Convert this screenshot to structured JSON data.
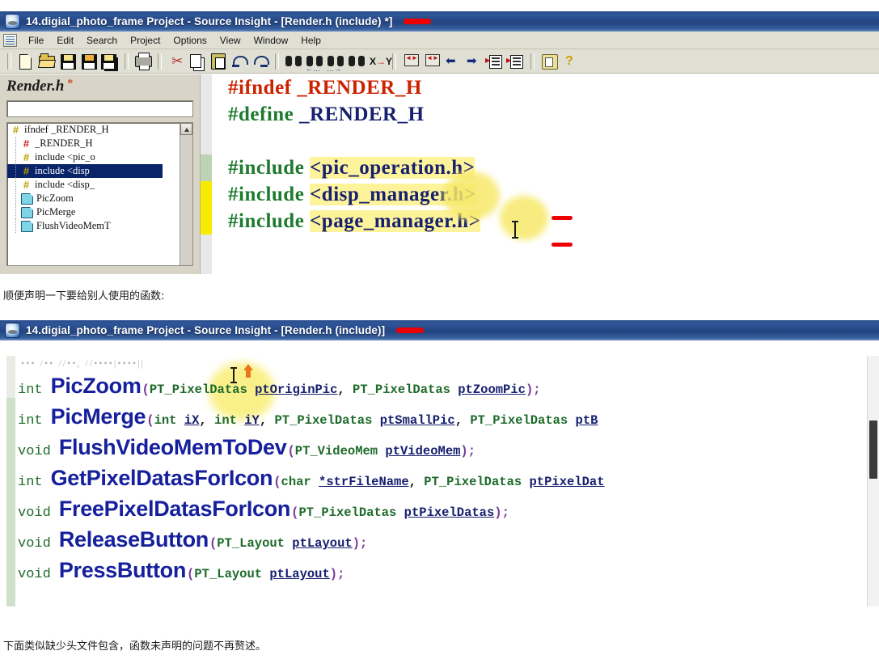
{
  "window1": {
    "title": "14.digial_photo_frame Project - Source Insight - [Render.h (include) *]",
    "title_annotation": "red-dash",
    "menu": [
      "File",
      "Edit",
      "Search",
      "Project",
      "Options",
      "View",
      "Window",
      "Help"
    ],
    "toolbar_icons": [
      "new-file-icon",
      "open-folder-icon",
      "save-icon",
      "save-as-icon",
      "save-all-icon",
      "print-icon",
      "cut-icon",
      "copy-icon",
      "paste-icon",
      "undo-icon",
      "redo-icon",
      "find-icon",
      "find-previous-icon",
      "find-next-icon",
      "find-in-files-icon",
      "replace-icon",
      "jump-back-box-icon",
      "jump-forward-box-icon",
      "back-arrow-icon",
      "forward-arrow-icon",
      "goto-line-icon",
      "symbol-list-icon",
      "context-window-icon",
      "help-icon"
    ],
    "symbol_pane": {
      "file_title": "Render.h",
      "modified_marker": "*",
      "search_value": "",
      "search_placeholder": "",
      "tree": [
        {
          "icon": "hash-yellow-icon",
          "label": "ifndef _RENDER_H",
          "depth": 0,
          "selected": false
        },
        {
          "icon": "hash-red-icon",
          "label": "_RENDER_H",
          "depth": 1,
          "selected": false
        },
        {
          "icon": "hash-yellow-icon",
          "label": "include <pic_o",
          "depth": 1,
          "selected": false
        },
        {
          "icon": "hash-yellow-icon",
          "label": "include <disp",
          "depth": 1,
          "selected": true
        },
        {
          "icon": "hash-yellow-icon",
          "label": "include <disp_",
          "depth": 1,
          "selected": false
        },
        {
          "icon": "page-icon",
          "label": "PicZoom",
          "depth": 1,
          "selected": false
        },
        {
          "icon": "page-icon",
          "label": "PicMerge",
          "depth": 1,
          "selected": false
        },
        {
          "icon": "page-icon",
          "label": "FlushVideoMemT",
          "depth": 1,
          "selected": false
        }
      ],
      "scroll_up_icon": "scroll-up-arrow-icon"
    },
    "code": {
      "lines": [
        {
          "directive": "#ifndef",
          "directive_color": "#cc2200",
          "symbol": "_RENDER_H",
          "symbol_color": "#cc2200",
          "highlighted": false,
          "gutter": "none"
        },
        {
          "directive": "#define",
          "directive_color": "#1e7a2e",
          "symbol": "_RENDER_H",
          "symbol_color": "#16206e",
          "highlighted": false,
          "gutter": "none"
        },
        {
          "directive": "",
          "symbol": "",
          "highlighted": false,
          "gutter": "none"
        },
        {
          "directive": "#include",
          "directive_color": "#1e7a2e",
          "symbol": "<pic_operation.h>",
          "symbol_color": "#16206e",
          "highlighted": true,
          "gutter": "green"
        },
        {
          "directive": "#include",
          "directive_color": "#1e7a2e",
          "symbol": "<disp_manager.h>",
          "symbol_color": "#16206e",
          "highlighted": true,
          "gutter": "yellow",
          "annotation": "red-dash"
        },
        {
          "directive": "#include",
          "directive_color": "#1e7a2e",
          "symbol": "<page_manager.h>",
          "symbol_color": "#16206e",
          "highlighted": true,
          "gutter": "yellow",
          "annotation": "red-dash"
        }
      ]
    }
  },
  "caption_middle": "顺便声明一下要给别人使用的函数:",
  "window2": {
    "title": "14.digial_photo_frame Project - Source Insight - [Render.h (include)]",
    "title_annotation": "red-dash",
    "functions": [
      {
        "return_type": "int",
        "name": "PicZoom",
        "signature_parts": [
          {
            "t": "(",
            "c": "paren"
          },
          {
            "t": "PT_PixelDatas ",
            "c": "type"
          },
          {
            "t": "ptOriginPic",
            "c": "var"
          },
          {
            "t": ", ",
            "c": "plain"
          },
          {
            "t": "PT_PixelDatas ",
            "c": "type"
          },
          {
            "t": "ptZoomPic",
            "c": "var"
          },
          {
            "t": ");",
            "c": "paren"
          }
        ]
      },
      {
        "return_type": "int",
        "name": "PicMerge",
        "signature_parts": [
          {
            "t": "(",
            "c": "paren"
          },
          {
            "t": "int ",
            "c": "kw"
          },
          {
            "t": "iX",
            "c": "var"
          },
          {
            "t": ", ",
            "c": "plain"
          },
          {
            "t": "int ",
            "c": "kw"
          },
          {
            "t": "iY",
            "c": "var"
          },
          {
            "t": ", ",
            "c": "plain"
          },
          {
            "t": "PT_PixelDatas ",
            "c": "type"
          },
          {
            "t": "ptSmallPic",
            "c": "var"
          },
          {
            "t": ", ",
            "c": "plain"
          },
          {
            "t": "PT_PixelDatas ",
            "c": "type"
          },
          {
            "t": "ptB",
            "c": "var"
          }
        ]
      },
      {
        "return_type": "void",
        "name": "FlushVideoMemToDev",
        "signature_parts": [
          {
            "t": "(",
            "c": "paren"
          },
          {
            "t": "PT_VideoMem ",
            "c": "type"
          },
          {
            "t": "ptVideoMem",
            "c": "var"
          },
          {
            "t": ");",
            "c": "paren"
          }
        ]
      },
      {
        "return_type": "int",
        "name": "GetPixelDatasForIcon",
        "signature_parts": [
          {
            "t": "(",
            "c": "paren"
          },
          {
            "t": "char ",
            "c": "kw"
          },
          {
            "t": "*strFileName",
            "c": "var"
          },
          {
            "t": ", ",
            "c": "plain"
          },
          {
            "t": "PT_PixelDatas ",
            "c": "type"
          },
          {
            "t": "ptPixelDat",
            "c": "var"
          }
        ]
      },
      {
        "return_type": "void",
        "name": "FreePixelDatasForIcon",
        "signature_parts": [
          {
            "t": "(",
            "c": "paren"
          },
          {
            "t": "PT_PixelDatas ",
            "c": "type"
          },
          {
            "t": "ptPixelDatas",
            "c": "var"
          },
          {
            "t": ");",
            "c": "paren"
          }
        ]
      },
      {
        "return_type": "void",
        "name": "ReleaseButton",
        "signature_parts": [
          {
            "t": "(",
            "c": "paren"
          },
          {
            "t": "PT_Layout ",
            "c": "type"
          },
          {
            "t": "ptLayout",
            "c": "var"
          },
          {
            "t": ");",
            "c": "paren"
          }
        ]
      },
      {
        "return_type": "void",
        "name": "PressButton",
        "signature_parts": [
          {
            "t": "(",
            "c": "paren"
          },
          {
            "t": "PT_Layout ",
            "c": "type"
          },
          {
            "t": "ptLayout",
            "c": "var"
          },
          {
            "t": ");",
            "c": "paren"
          }
        ]
      }
    ],
    "mouse_cursor": "orange-up-arrow-cursor",
    "text_caret": "i-beam-caret"
  },
  "caption_bottom": "下面类似缺少头文件包含，函数未声明的问题不再赘述。",
  "colors": {
    "title_blue": "#2b4d8e",
    "annotation_red": "#ee0000",
    "selection_blue": "#0a246a",
    "highlight_yellow": "#fdf39a",
    "gutter_green": "#bcd3b4",
    "gutter_yellow": "#f7ec00",
    "function_name_blue": "#16209c",
    "keyword_green": "#1e6b2a",
    "preproc_red": "#cc2200"
  }
}
